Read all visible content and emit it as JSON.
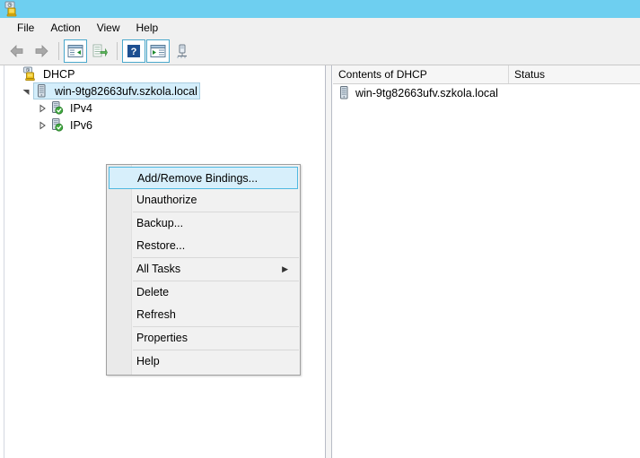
{
  "window": {
    "title": "",
    "icon": "dhcp-server-icon",
    "titlebar_color": "#6ecff0"
  },
  "menubar": {
    "items": [
      {
        "label": "File",
        "name": "menu-file"
      },
      {
        "label": "Action",
        "name": "menu-action"
      },
      {
        "label": "View",
        "name": "menu-view"
      },
      {
        "label": "Help",
        "name": "menu-help"
      }
    ]
  },
  "toolbar": {
    "buttons": [
      {
        "icon": "back-arrow-icon",
        "framed": false
      },
      {
        "icon": "forward-arrow-icon",
        "framed": false
      },
      {
        "icon": "show-hide-console-tree-icon",
        "framed": true
      },
      {
        "icon": "export-list-icon",
        "framed": false
      },
      {
        "icon": "help-icon",
        "framed": true
      },
      {
        "icon": "show-hide-action-pane-icon",
        "framed": true
      },
      {
        "icon": "refresh-server-icon",
        "framed": false
      }
    ]
  },
  "tree": {
    "nodes": [
      {
        "label": "DHCP",
        "icon": "dhcp-console-icon",
        "level": 0,
        "expanded": true,
        "selected": false,
        "twisty": ""
      },
      {
        "label": "win-9tg82663ufv.szkola.local",
        "icon": "server-icon",
        "level": 1,
        "expanded": true,
        "selected": true,
        "twisty": "expanded"
      },
      {
        "label": "IPv4",
        "icon": "server-ok-icon",
        "level": 2,
        "expanded": false,
        "selected": false,
        "twisty": "collapsed"
      },
      {
        "label": "IPv6",
        "icon": "server-ok-icon",
        "level": 2,
        "expanded": false,
        "selected": false,
        "twisty": "collapsed"
      }
    ]
  },
  "list": {
    "columns": [
      {
        "label": "Contents of DHCP",
        "name": "column-contents-of-dhcp"
      },
      {
        "label": "Status",
        "name": "column-status"
      }
    ],
    "rows": [
      {
        "name": "win-9tg82663ufv.szkola.local",
        "status": "",
        "icon": "server-icon"
      }
    ]
  },
  "context_menu": {
    "items": [
      {
        "label": "Add/Remove Bindings...",
        "highlighted": true,
        "submenu": false,
        "sep_after": false
      },
      {
        "label": "Unauthorize",
        "highlighted": false,
        "submenu": false,
        "sep_after": true
      },
      {
        "label": "Backup...",
        "highlighted": false,
        "submenu": false,
        "sep_after": false
      },
      {
        "label": "Restore...",
        "highlighted": false,
        "submenu": false,
        "sep_after": true
      },
      {
        "label": "All Tasks",
        "highlighted": false,
        "submenu": true,
        "sep_after": true
      },
      {
        "label": "Delete",
        "highlighted": false,
        "submenu": false,
        "sep_after": false
      },
      {
        "label": "Refresh",
        "highlighted": false,
        "submenu": false,
        "sep_after": true
      },
      {
        "label": "Properties",
        "highlighted": false,
        "submenu": false,
        "sep_after": true
      },
      {
        "label": "Help",
        "highlighted": false,
        "submenu": false,
        "sep_after": false
      }
    ],
    "submenu_arrow_glyph": "▶"
  },
  "colors": {
    "accent": "#6ecff0",
    "selection": "#d4eefb",
    "highlight_border": "#4fb8e0",
    "pane_bg": "#ffffff",
    "chrome_bg": "#f0f0f0"
  }
}
